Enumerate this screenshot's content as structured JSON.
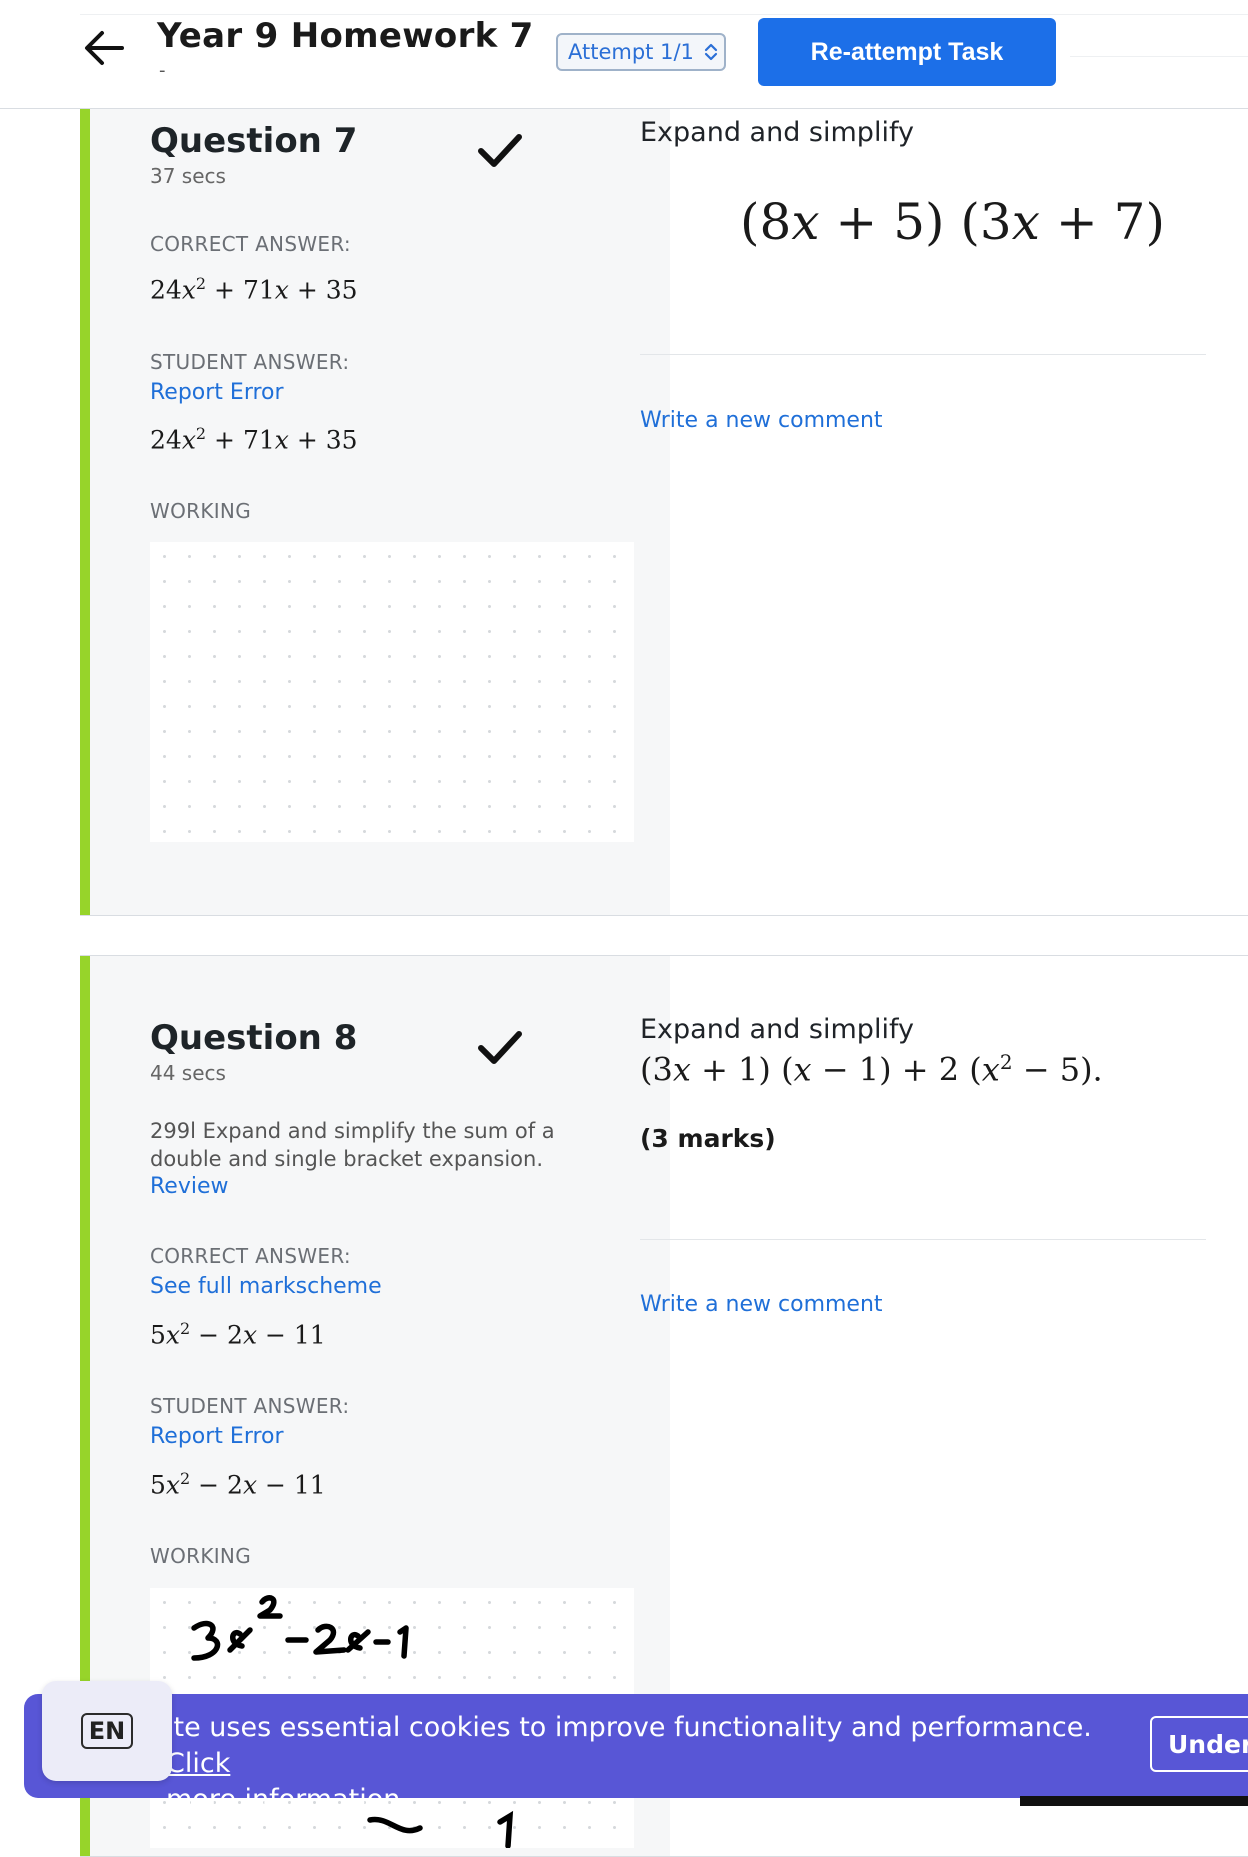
{
  "header": {
    "title": "Year 9 Homework 7",
    "subtitle": "-",
    "attempt_label": "Attempt 1/1",
    "reattempt_label": "Re-attempt Task"
  },
  "questions": [
    {
      "title": "Question 7",
      "time": "37 secs",
      "status": "correct",
      "correct_label": "CORRECT ANSWER:",
      "student_label": "STUDENT ANSWER:",
      "report_label": "Report Error",
      "working_label": "WORKING",
      "prompt": "Expand and simplify",
      "comment_label": "Write a new comment"
    },
    {
      "title": "Question 8",
      "time": "44 secs",
      "status": "correct",
      "description": "299l Expand and simplify the sum of a double and single bracket expansion.",
      "review_label": "Review",
      "correct_label": "CORRECT ANSWER:",
      "markscheme_label": "See full markscheme",
      "student_label": "STUDENT ANSWER:",
      "report_label": "Report Error",
      "working_label": "WORKING",
      "prompt": "Expand and simplify",
      "marks": "(3 marks)",
      "comment_label": "Write a new comment"
    }
  ],
  "cookie": {
    "text": "ite uses essential cookies to improve functionality and performance.",
    "link_click": "Click",
    "link_more": "more information.",
    "button_label": "Unders",
    "language": "EN"
  },
  "colors": {
    "accent": "#1c6fe8",
    "correct_bar": "#97d42a",
    "cookie_bg": "#5856d6"
  },
  "icons": [
    "back-arrow-icon",
    "chevron-updown-icon",
    "checkmark-icon"
  ]
}
